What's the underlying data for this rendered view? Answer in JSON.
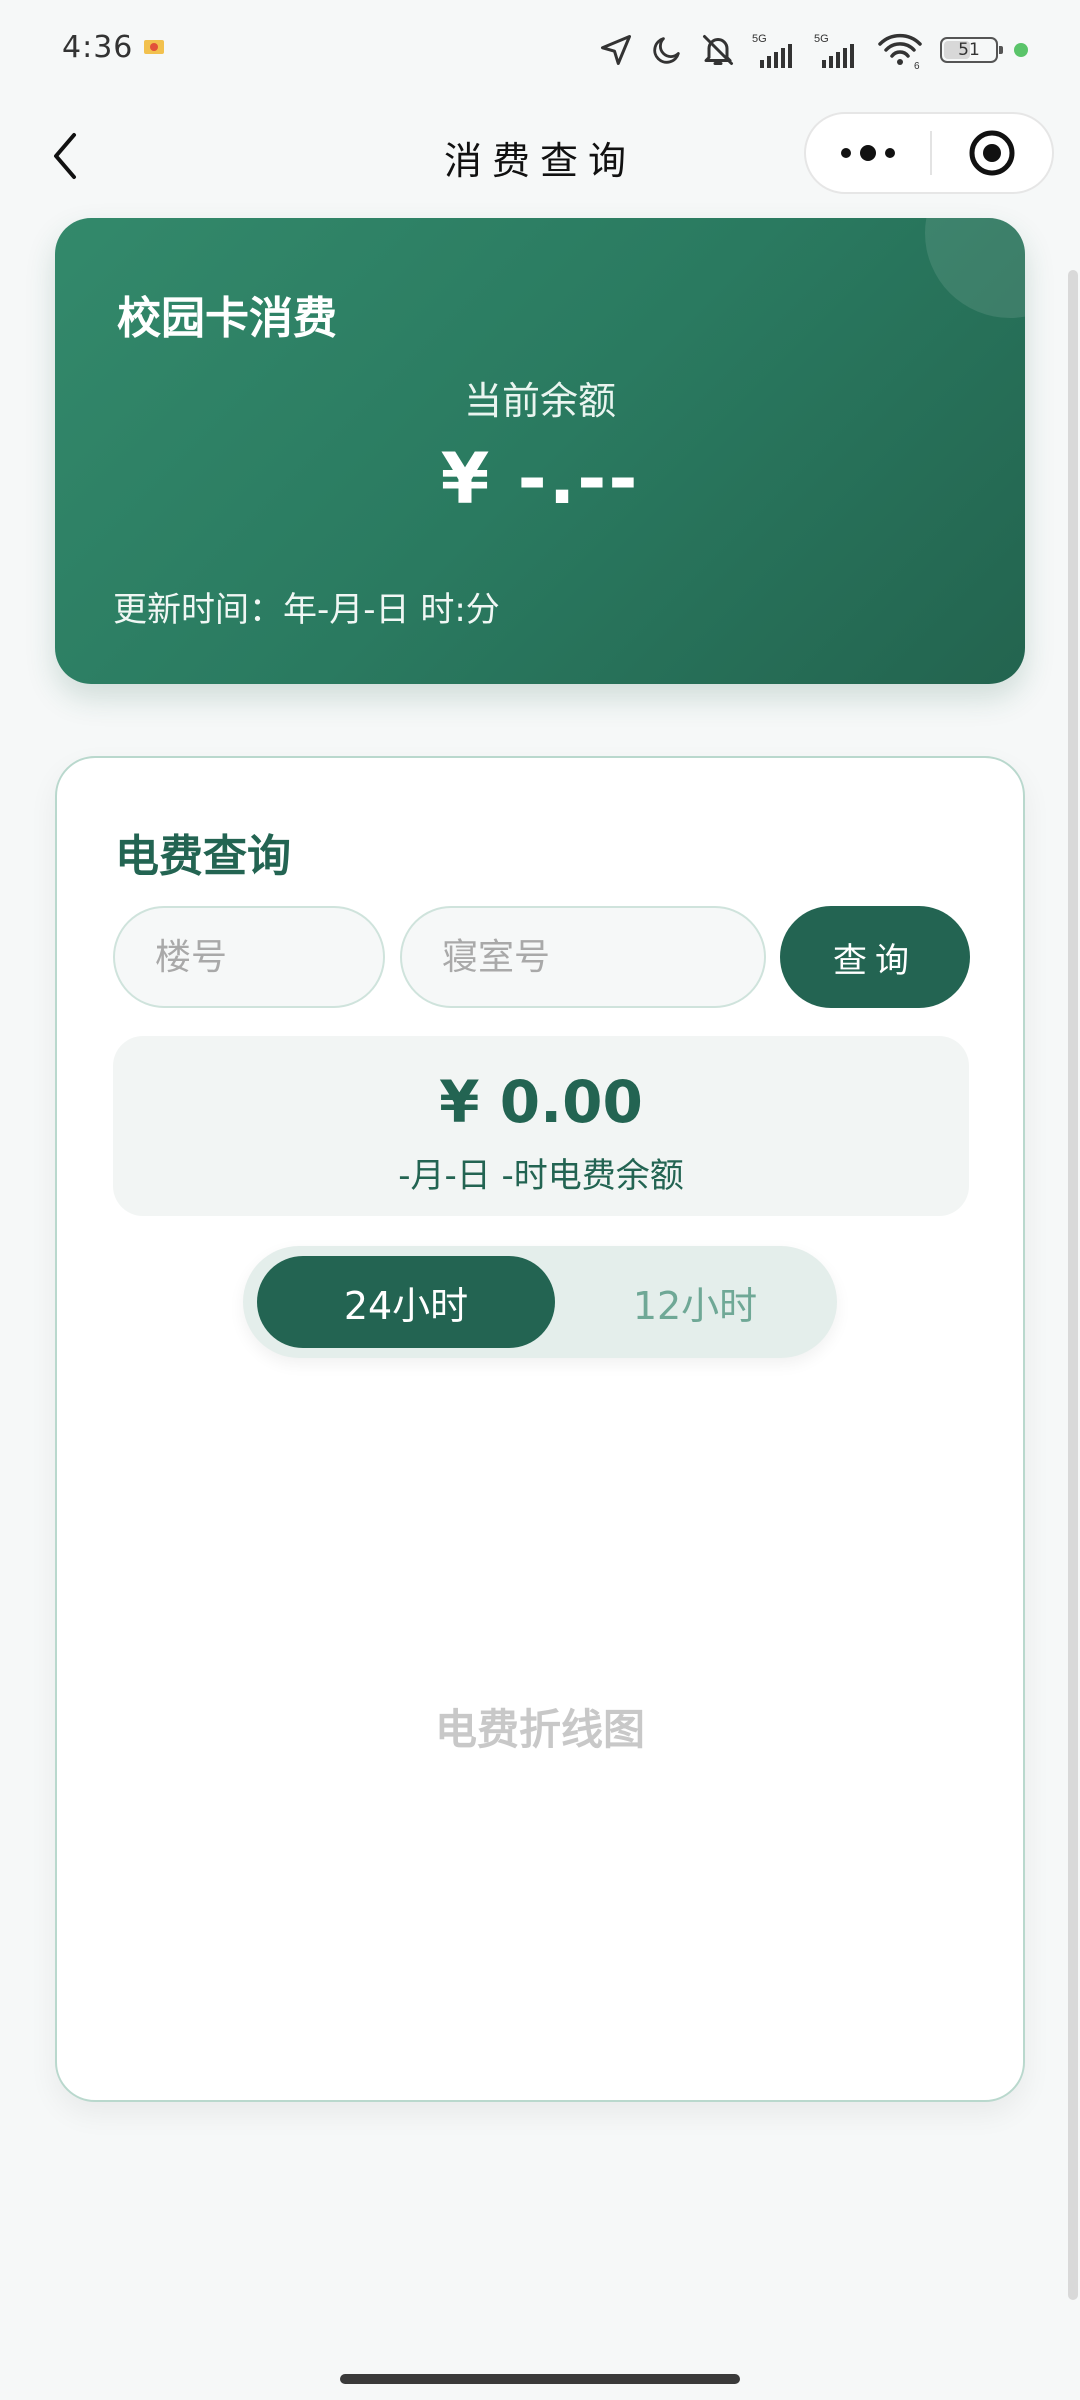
{
  "status_bar": {
    "time": "4:36",
    "signal_label_1": "5G",
    "signal_label_2": "5G",
    "wifi_label": "6",
    "battery_level": "51",
    "icons": [
      "mail-icon",
      "location-icon",
      "moon-icon",
      "bell-muted-icon",
      "signal-icon",
      "signal-icon",
      "wifi-icon",
      "battery-icon",
      "green-dot-icon"
    ]
  },
  "nav": {
    "title": "消费查询",
    "back_icon": "chevron-left-icon",
    "more_icon": "more-dots-icon",
    "close_icon": "target-close-icon"
  },
  "campus_card": {
    "title": "校园卡消费",
    "balance_label": "当前余额",
    "balance_value": "¥ -.--",
    "update_time": "更新时间：年-月-日 时:分"
  },
  "electricity": {
    "title": "电费查询",
    "building_placeholder": "楼号",
    "room_placeholder": "寝室号",
    "query_button": "查询",
    "balance_value": "¥ 0.00",
    "balance_label": "-月-日 -时电费余额",
    "toggle": {
      "options": [
        "24小时",
        "12小时"
      ],
      "selected": "24小时"
    },
    "chart_placeholder": "电费折线图"
  },
  "colors": {
    "primary": "#236452",
    "card_gradient_start": "#33896b",
    "card_gradient_end": "#23644f",
    "muted_green": "#6fa896",
    "background": "#f6f8f8"
  }
}
